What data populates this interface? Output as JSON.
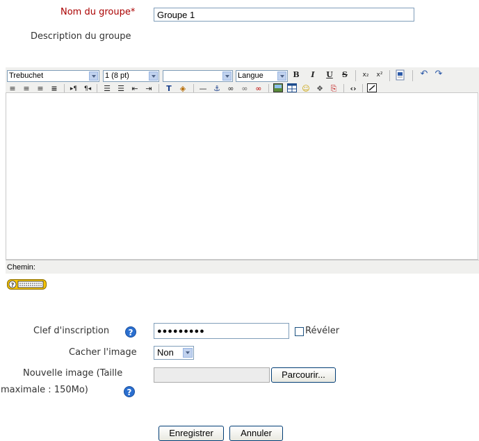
{
  "form": {
    "group_name_label": "Nom du groupe",
    "required_mark": "*",
    "group_name_value": "Groupe 1",
    "description_label": "Description du groupe"
  },
  "editor": {
    "font_select": "Trebuchet",
    "size_select": "1 (8 pt)",
    "format_select": "",
    "language_select": "Langue",
    "path_label": "Chemin:",
    "toolbar_icons": [
      "bold-icon",
      "italic-icon",
      "underline-icon",
      "strikethrough-icon",
      "subscript-icon",
      "superscript-icon",
      "paste-word-icon",
      "undo-icon",
      "redo-icon",
      "align-left-icon",
      "align-center-icon",
      "align-right-icon",
      "justify-icon",
      "ltr-icon",
      "rtl-icon",
      "ordered-list-icon",
      "unordered-list-icon",
      "outdent-icon",
      "indent-icon",
      "text-color-icon",
      "background-color-icon",
      "horizontal-rule-icon",
      "anchor-icon",
      "link-icon",
      "unlink-icon",
      "nolink-icon",
      "insert-image-icon",
      "insert-table-icon",
      "smiley-icon",
      "special-char-icon",
      "search-replace-icon",
      "html-source-icon",
      "fullscreen-icon"
    ]
  },
  "enrolment": {
    "key_label": "Clef d'inscription",
    "key_value": "●●●●●●●●●",
    "reveal_label": "Révéler"
  },
  "hide_picture": {
    "label": "Cacher l'image",
    "value": "Non"
  },
  "new_picture": {
    "label_line1": "Nouvelle image (Taille",
    "label_line2": "maximale : 150Mo)",
    "browse_label": "Parcourir..."
  },
  "actions": {
    "save_label": "Enregistrer",
    "cancel_label": "Annuler"
  }
}
